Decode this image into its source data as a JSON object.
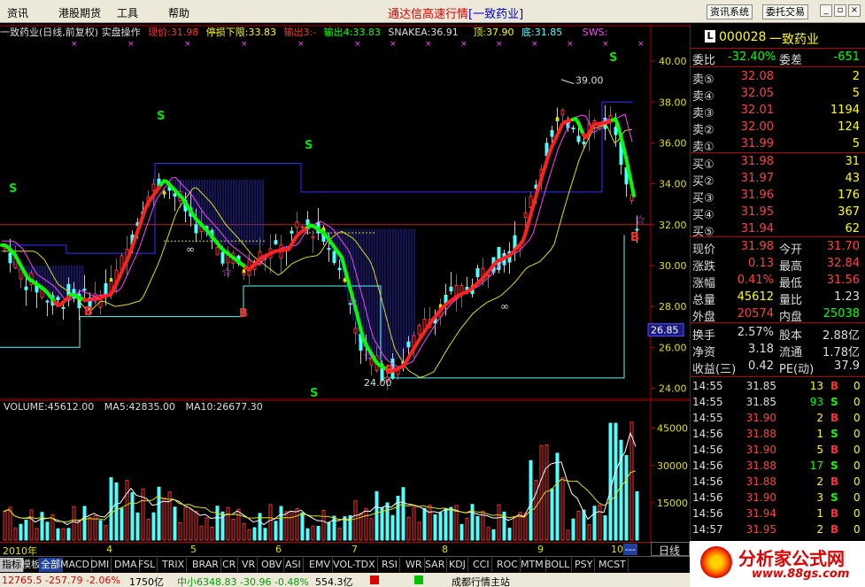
{
  "menubar": {
    "items": [
      "资讯",
      "港股期货",
      "工具",
      "帮助"
    ],
    "title_app": "通达信高速行情",
    "title_stock": "[一致药业]",
    "btn_info": "资讯系统",
    "btn_trade": "委托交易"
  },
  "chart": {
    "header_name": "一致药业(日线,前复权) 实盘操作",
    "now_price": "现价:31.98",
    "stop_loss": "停损下限:33.83",
    "out3": "输出3:-",
    "out4": "输出4:33.83",
    "snakea": "SNAKEA:36.91",
    "top": "顶:37.90",
    "bottom": "底:31.85",
    "sws": "SWS:",
    "price_axis": [
      "40.00",
      "38.00",
      "36.00",
      "34.00",
      "32.00",
      "30.00",
      "28.00",
      "26.00",
      "24.00"
    ],
    "price_marker": "26.85",
    "high_label": "39.00",
    "low_label": "24.00",
    "signal_s": "S",
    "signal_b": "B",
    "inf": "∞",
    "ylim": [
      23.5,
      41.0
    ]
  },
  "volume": {
    "label": "VOLUME:45612.00",
    "ma5": "MA5:42835.00",
    "ma10": "MA10:26677.30",
    "axis": [
      "45000",
      "30000",
      "15000"
    ],
    "ylim": [
      0,
      52000
    ]
  },
  "xaxis": {
    "labels": [
      "2010年",
      "4",
      "5",
      "6",
      "7",
      "8",
      "9",
      "10"
    ],
    "end": "---"
  },
  "period": "日线",
  "quote": {
    "code_badge": "L",
    "code": "000028",
    "name": "一致药业",
    "wei_bi_label": "委比",
    "wei_bi": "-32.40%",
    "wei_cha_label": "委差",
    "wei_cha": "-651",
    "asks": [
      {
        "label": "卖⑤",
        "price": "32.08",
        "vol": "2"
      },
      {
        "label": "卖④",
        "price": "32.05",
        "vol": "5"
      },
      {
        "label": "卖③",
        "price": "32.01",
        "vol": "1194"
      },
      {
        "label": "卖②",
        "price": "32.00",
        "vol": "124"
      },
      {
        "label": "卖①",
        "price": "31.99",
        "vol": "5"
      }
    ],
    "bids": [
      {
        "label": "买①",
        "price": "31.98",
        "vol": "31"
      },
      {
        "label": "买②",
        "price": "31.97",
        "vol": "43"
      },
      {
        "label": "买③",
        "price": "31.96",
        "vol": "176"
      },
      {
        "label": "买④",
        "price": "31.95",
        "vol": "367"
      },
      {
        "label": "买⑤",
        "price": "31.94",
        "vol": "62"
      }
    ],
    "stats": [
      {
        "l1": "现价",
        "v1": "31.98",
        "c1": "#ff4040",
        "l2": "今开",
        "v2": "31.70",
        "c2": "#ff4040"
      },
      {
        "l1": "涨跌",
        "v1": "0.13",
        "c1": "#ff4040",
        "l2": "最高",
        "v2": "32.84",
        "c2": "#ff4040"
      },
      {
        "l1": "涨幅",
        "v1": "0.41%",
        "c1": "#ff4040",
        "l2": "最低",
        "v2": "31.56",
        "c2": "#ff4040"
      },
      {
        "l1": "总量",
        "v1": "45612",
        "c1": "#ffff00",
        "l2": "量比",
        "v2": "1.23",
        "c2": "#dddddd"
      },
      {
        "l1": "外盘",
        "v1": "20574",
        "c1": "#ff4040",
        "l2": "内盘",
        "v2": "25038",
        "c2": "#00ff00"
      }
    ],
    "stats2": [
      {
        "l1": "换手",
        "v1": "2.57%",
        "c1": "#dddddd",
        "l2": "股本",
        "v2": "2.88亿",
        "c2": "#dddddd"
      },
      {
        "l1": "净资",
        "v1": "3.18",
        "c1": "#dddddd",
        "l2": "流通",
        "v2": "1.78亿",
        "c2": "#dddddd"
      },
      {
        "l1": "收益(三)",
        "v1": "0.42",
        "c1": "#dddddd",
        "l2": "PE(动)",
        "v2": "37.9",
        "c2": "#dddddd"
      }
    ],
    "ticks": [
      {
        "t": "14:55",
        "p": "31.85",
        "pc": "#dddddd",
        "v": "13",
        "vc": "#ffff00",
        "d": "B",
        "dc": "#ff3030"
      },
      {
        "t": "14:55",
        "p": "31.85",
        "pc": "#dddddd",
        "v": "93",
        "vc": "#00ff00",
        "d": "S",
        "dc": "#00ff00"
      },
      {
        "t": "14:55",
        "p": "31.90",
        "pc": "#ff4040",
        "v": "2",
        "vc": "#ffff00",
        "d": "B",
        "dc": "#ff3030"
      },
      {
        "t": "14:56",
        "p": "31.88",
        "pc": "#ff4040",
        "v": "1",
        "vc": "#ffff00",
        "d": "S",
        "dc": "#00ff00"
      },
      {
        "t": "14:56",
        "p": "31.90",
        "pc": "#ff4040",
        "v": "5",
        "vc": "#ffff00",
        "d": "B",
        "dc": "#ff3030"
      },
      {
        "t": "14:56",
        "p": "31.88",
        "pc": "#ff4040",
        "v": "17",
        "vc": "#00ff00",
        "d": "S",
        "dc": "#00ff00"
      },
      {
        "t": "14:56",
        "p": "31.88",
        "pc": "#ff4040",
        "v": "2",
        "vc": "#ffff00",
        "d": "B",
        "dc": "#ff3030"
      },
      {
        "t": "14:56",
        "p": "31.90",
        "pc": "#ff4040",
        "v": "3",
        "vc": "#ffff00",
        "d": "S",
        "dc": "#00ff00"
      },
      {
        "t": "14:56",
        "p": "31.94",
        "pc": "#ff4040",
        "v": "1",
        "vc": "#ffff00",
        "d": "B",
        "dc": "#ff3030"
      },
      {
        "t": "14:57",
        "p": "31.95",
        "pc": "#ff4040",
        "v": "2",
        "vc": "#ffff00",
        "d": "B",
        "dc": "#ff3030"
      }
    ]
  },
  "tabs": [
    "指标",
    "模板",
    "全部",
    "MACD",
    "DMI",
    "DMA",
    "FSL",
    "TRIX",
    "BRAR",
    "CR",
    "VR",
    "OBV",
    "ASI",
    "EMV",
    "VOL-TDX",
    "RSI",
    "WR",
    "SAR",
    "KDJ",
    "CCI",
    "ROC",
    "MTM",
    "BOLL",
    "PSY",
    "MCST"
  ],
  "status": {
    "s1": "12765.5 -257.79 -2.06%",
    "s2": "1750亿",
    "s3": "中小6348.83 -30.96 -0.48%",
    "s4": "554.3亿",
    "s5": "成都行情主站"
  },
  "logo": {
    "line1": "分析家公式网",
    "line2": "www.88gs.com"
  },
  "colors": {
    "up": "#ff3030",
    "down": "#54fcfc",
    "axis": "#b00000",
    "grid": "#b00000",
    "green": "#00ff00",
    "yellow": "#ffff00"
  }
}
